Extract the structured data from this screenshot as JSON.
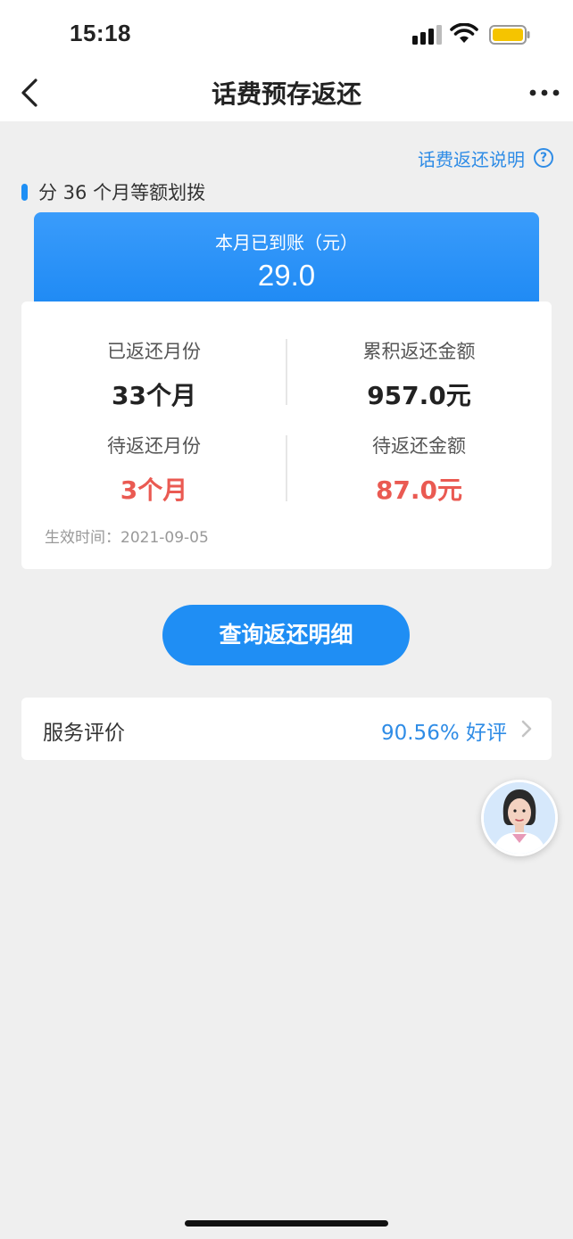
{
  "status_bar": {
    "time": "15:18"
  },
  "nav": {
    "title": "话费预存返还"
  },
  "explain_link": {
    "label": "话费返还说明",
    "help_glyph": "?"
  },
  "section": {
    "title": "分 36 个月等额划拨"
  },
  "month_card": {
    "label": "本月已到账（元）",
    "value": "29.0"
  },
  "stats": {
    "returned_months_label": "已返还月份",
    "returned_months_value": "33个月",
    "accumulated_label": "累积返还金额",
    "accumulated_value": "957.0元",
    "pending_months_label": "待返还月份",
    "pending_months_value": "3个月",
    "pending_amount_label": "待返还金额",
    "pending_amount_value": "87.0元",
    "effective_time": "生效时间：2021-09-05"
  },
  "query_button": {
    "label": "查询返还明细"
  },
  "evaluation": {
    "label": "服务评价",
    "value": "90.56% 好评"
  },
  "colors": {
    "accent": "#1f8ef4",
    "link": "#2f8ce6",
    "warning": "#ea5a52",
    "background": "#efefef"
  },
  "icons": {
    "back": "chevron-left-icon",
    "more": "more-dots-icon",
    "help": "help-icon",
    "chevron": "chevron-right-icon",
    "assistant": "assistant-avatar"
  }
}
